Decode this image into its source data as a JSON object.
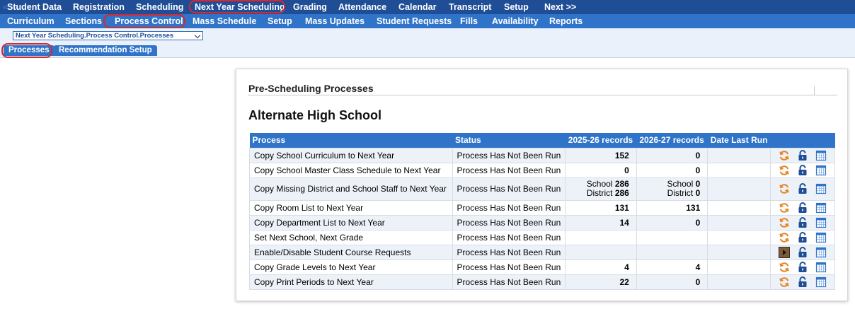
{
  "top_nav": [
    "Student Data",
    "Registration",
    "Scheduling",
    "Next Year Scheduling",
    "Grading",
    "Attendance",
    "Calendar",
    "Transcript",
    "Setup",
    "Next >>"
  ],
  "sub_nav": [
    "Curriculum",
    "Sections",
    "Process Control",
    "Mass Schedule",
    "Setup",
    "Mass Updates",
    "Student Requests",
    "Fills",
    "Availability",
    "Reports"
  ],
  "breadcrumb": {
    "back": "«",
    "selected": "Next Year Scheduling.Process Control.Processes"
  },
  "tabs": [
    "Processes",
    "Recommendation Setup"
  ],
  "section_title": "Pre-Scheduling Processes",
  "school_name": "Alternate High School",
  "table": {
    "headers": [
      "Process",
      "Status",
      "2025-26 records",
      "2026-27 records",
      "Date Last Run"
    ],
    "rows": [
      {
        "process": "Copy School Curriculum to Next Year",
        "status": "Process Has Not Been Run",
        "r1": "152",
        "r2": "0",
        "last": "",
        "action": "refresh"
      },
      {
        "process": "Copy School Master Class Schedule to Next Year",
        "status": "Process Has Not Been Run",
        "r1": "0",
        "r2": "0",
        "last": "",
        "action": "refresh"
      },
      {
        "process": "Copy Missing District and School Staff to Next Year",
        "status": "Process Has Not Been Run",
        "r1a_label": "School",
        "r1a": "286",
        "r1b_label": "District",
        "r1b": "286",
        "r2a_label": "School",
        "r2a": "0",
        "r2b_label": "District",
        "r2b": "0",
        "last": "",
        "action": "refresh"
      },
      {
        "process": "Copy Room List to Next Year",
        "status": "Process Has Not Been Run",
        "r1": "131",
        "r2": "131",
        "last": "",
        "action": "refresh"
      },
      {
        "process": "Copy Department List to Next Year",
        "status": "Process Has Not Been Run",
        "r1": "14",
        "r2": "0",
        "last": "",
        "action": "refresh"
      },
      {
        "process": "Set Next School, Next Grade",
        "status": "Process Has Not Been Run",
        "r1": "",
        "r2": "",
        "last": "",
        "action": "refresh"
      },
      {
        "process": "Enable/Disable Student Course Requests",
        "status": "Process Has Not Been Run",
        "r1": "",
        "r2": "",
        "last": "",
        "action": "play"
      },
      {
        "process": "Copy Grade Levels to Next Year",
        "status": "Process Has Not Been Run",
        "r1": "4",
        "r2": "4",
        "last": "",
        "action": "refresh"
      },
      {
        "process": "Copy Print Periods to Next Year",
        "status": "Process Has Not Been Run",
        "r1": "22",
        "r2": "0",
        "last": "",
        "action": "refresh"
      }
    ]
  },
  "icons": {
    "refresh": "refresh-icon",
    "play": "play-icon",
    "lock": "lock-icon",
    "calendar": "calendar-icon"
  },
  "colors": {
    "top_nav": "#1f4e96",
    "sub_nav": "#2f74c9",
    "highlight": "#d9272e",
    "refresh": "#e8821e"
  }
}
